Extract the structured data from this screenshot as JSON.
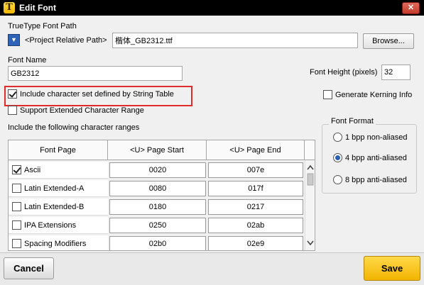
{
  "window": {
    "title": "Edit Font",
    "app_icon_glyph": "T",
    "close_glyph": "✕"
  },
  "font_path": {
    "label": "TrueType Font Path",
    "dropdown_arrow": "▼",
    "path_type": "<Project Relative Path>",
    "file_name": "楷体_GB2312.ttf",
    "browse_label": "Browse..."
  },
  "font_name": {
    "label": "Font Name",
    "value": "GB2312"
  },
  "font_height": {
    "label": "Font Height (pixels)",
    "value": "32"
  },
  "options": {
    "include_string_table": {
      "label": "Include character set defined by String Table",
      "checked": true
    },
    "generate_kerning": {
      "label": "Generate Kerning Info",
      "checked": false
    },
    "extended_range": {
      "label": "Support Extended Character Range",
      "checked": false
    }
  },
  "ranges": {
    "label": "Include the following character ranges",
    "columns": [
      "Font Page",
      "<U> Page Start",
      "<U> Page End"
    ],
    "rows": [
      {
        "name": "Ascii",
        "start": "0020",
        "end": "007e",
        "checked": true
      },
      {
        "name": "Latin Extended-A",
        "start": "0080",
        "end": "017f",
        "checked": false
      },
      {
        "name": "Latin Extended-B",
        "start": "0180",
        "end": "0217",
        "checked": false
      },
      {
        "name": "IPA Extensions",
        "start": "0250",
        "end": "02ab",
        "checked": false
      },
      {
        "name": "Spacing Modifiers",
        "start": "02b0",
        "end": "02e9",
        "checked": false
      }
    ]
  },
  "font_format": {
    "label": "Font Format",
    "options": [
      {
        "label": "1 bpp non-aliased",
        "selected": false
      },
      {
        "label": "4 bpp anti-aliased",
        "selected": true
      },
      {
        "label": "8 bpp anti-aliased",
        "selected": false
      }
    ]
  },
  "footer": {
    "cancel_label": "Cancel",
    "save_label": "Save"
  },
  "colors": {
    "highlight_border": "#e02b2b",
    "save_button": "#f6c418",
    "title_bar": "#000000"
  }
}
